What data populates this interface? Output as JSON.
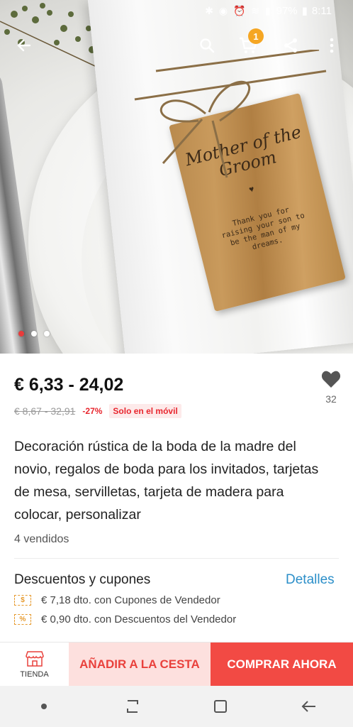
{
  "status_bar": {
    "battery": "97%",
    "time": "8:11"
  },
  "header": {
    "cart_count": "1"
  },
  "hero": {
    "tag_title": "Mother of the Groom",
    "tag_text": "Thank you for raising your son to be the man of my dreams.",
    "gallery_dots": 3,
    "active_dot": 1
  },
  "product": {
    "price": "€ 6,33 - 24,02",
    "old_price": "€ 8,67 - 32,91",
    "discount": "-27%",
    "mobile_only": "Solo en el móvil",
    "wishlist_count": "32",
    "title": "Decoración rústica de la boda de la madre del novio, regalos de boda para los invitados, tarjetas de mesa, servilletas, tarjeta de madera para colocar, personalizar",
    "sold": "4 vendidos"
  },
  "coupons": {
    "title": "Descuentos y cupones",
    "details_label": "Detalles",
    "items": [
      {
        "icon_text": "$",
        "text": "€ 7,18 dto. con Cupones de Vendedor"
      },
      {
        "icon_text": "%",
        "text": "€ 0,90 dto. con Descuentos del Vendedor"
      }
    ]
  },
  "actions": {
    "store_label": "TIENDA",
    "add_to_cart": "AÑADIR A LA CESTA",
    "buy_now": "COMPRAR AHORA"
  },
  "colors": {
    "accent_red": "#f24a44",
    "light_red": "#fde0de",
    "link_blue": "#2c8fc9",
    "badge_orange": "#f5a623"
  }
}
